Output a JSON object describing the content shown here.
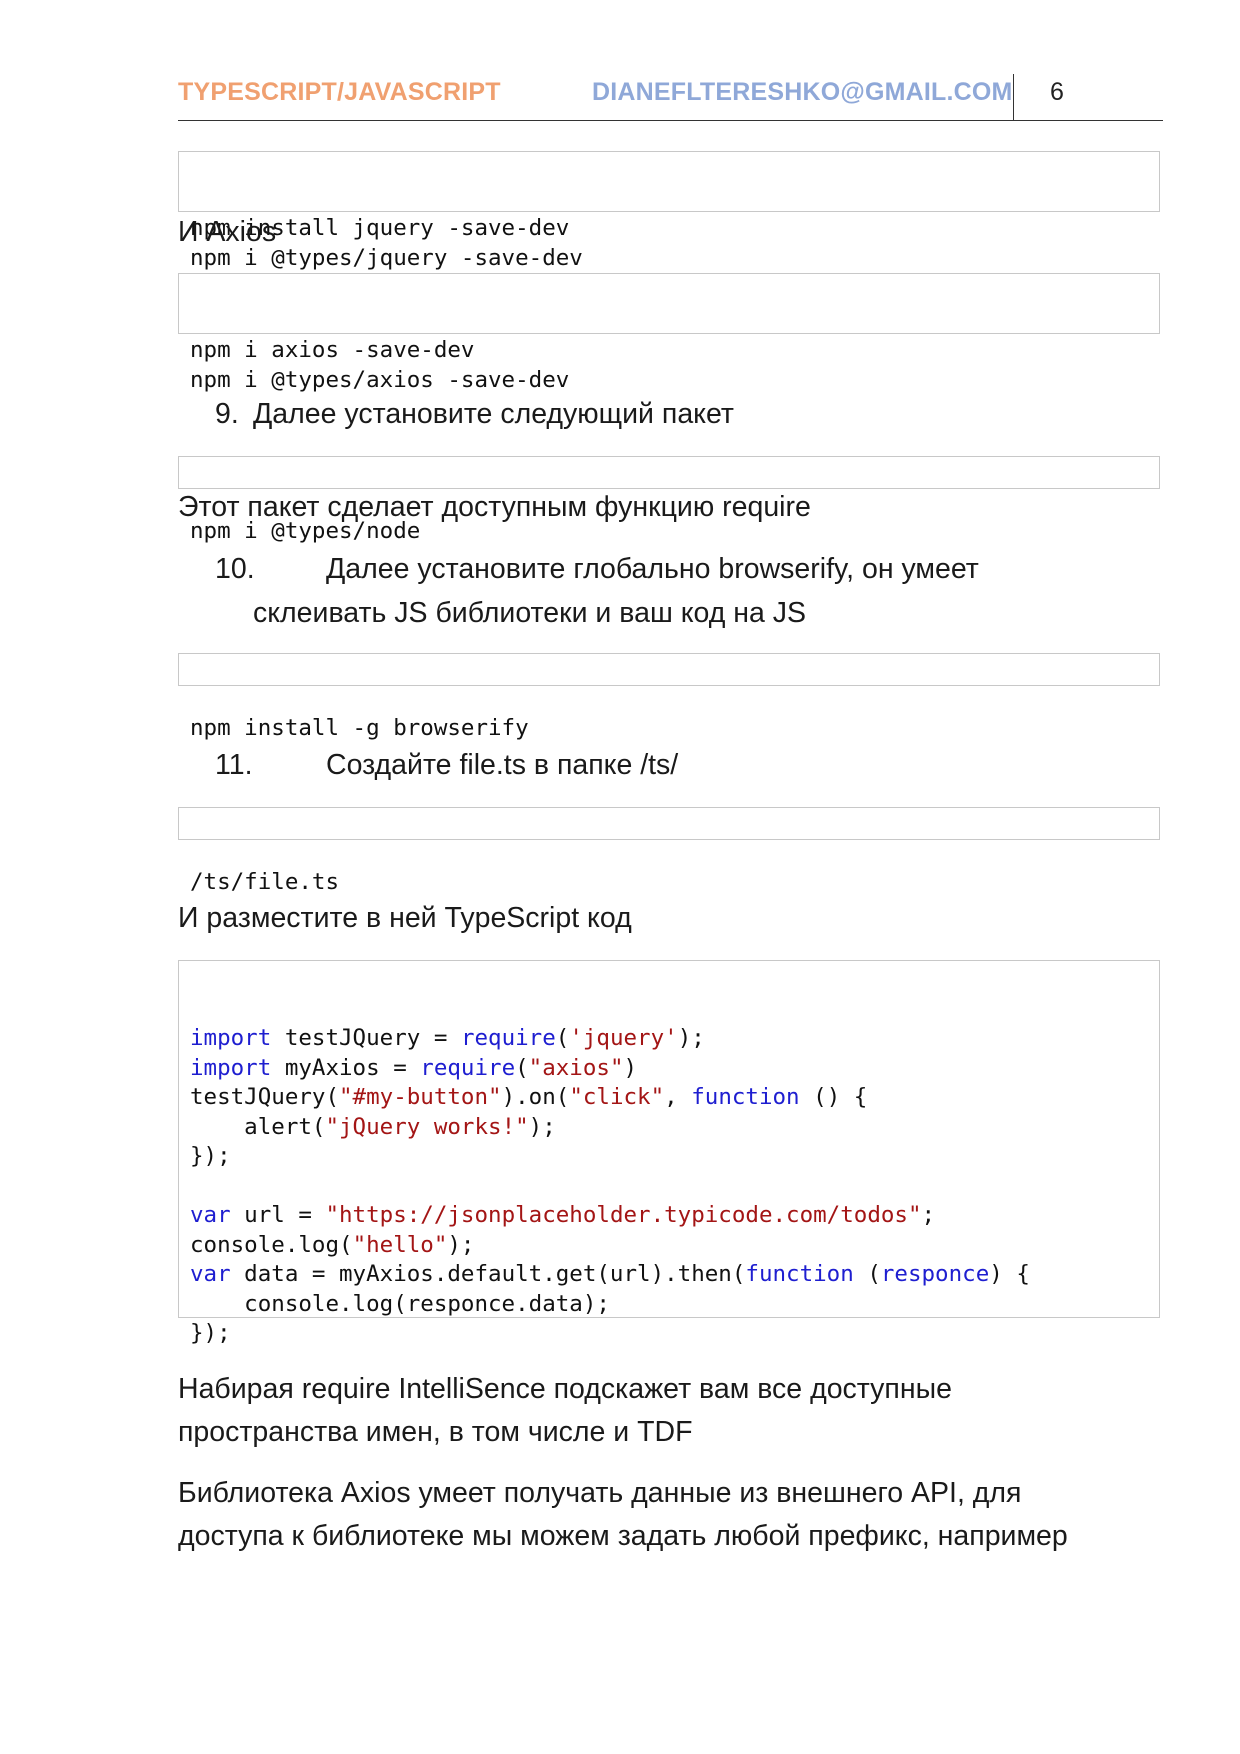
{
  "header": {
    "title": "TYPESCRIPT/JAVASCRIPT",
    "email": "DIANEFLTERESHKO@GMAIL.COM",
    "page_number": "6",
    "title_color": "#f0a070",
    "email_color": "#8fa8d8"
  },
  "code_jquery": [
    "npm install jquery -save-dev",
    "npm i @types/jquery -save-dev"
  ],
  "axios_label": "И Axios",
  "code_axios": [
    "npm i axios -save-dev",
    "npm i @types/axios -save-dev"
  ],
  "step9": {
    "num": "9.",
    "text": "Далее установите следующий пакет"
  },
  "code_node": "npm i @types/node",
  "node_note": "Этот пакет сделает доступным функцию require",
  "step10": {
    "num": "10.",
    "text_line1": "Далее установите глобально browserify, он умеет",
    "text_line2": "склеивать JS библиотеки и ваш код на JS"
  },
  "code_browserify": "npm install -g browserify",
  "step11": {
    "num": "11.",
    "text": "Создайте file.ts в папке /ts/"
  },
  "code_path": "/ts/file.ts",
  "place_code_label": "И разместите в ней TypeScript код",
  "ts_code": {
    "l1": {
      "kw1": "import",
      "t1": " testJQuery = ",
      "kw2": "require",
      "t2": "(",
      "s1": "'jquery'",
      "t3": ");"
    },
    "l2": {
      "kw1": "import",
      "t1": " myAxios = ",
      "kw2": "require",
      "t2": "(",
      "s1": "\"axios\"",
      "t3": ")"
    },
    "l3": {
      "t1": "testJQuery(",
      "s1": "\"#my-button\"",
      "t2": ").on(",
      "s2": "\"click\"",
      "t3": ", ",
      "kw1": "function",
      "t4": " () {"
    },
    "l4": {
      "t1": "    alert(",
      "s1": "\"jQuery works!\"",
      "t2": ");"
    },
    "l5": "});",
    "l7": {
      "kw1": "var",
      "t1": " url = ",
      "s1": "\"https://jsonplaceholder.typicode.com/todos\"",
      "t2": ";"
    },
    "l8": {
      "t1": "console.log(",
      "s1": "\"hello\"",
      "t2": ");"
    },
    "l9": {
      "kw1": "var",
      "t1": " data = myAxios.default.get(url).then(",
      "kw2": "function",
      "t2": " (",
      "kw3": "responce",
      "t3": ") {"
    },
    "l10": "    console.log(responce.data);",
    "l11": "});"
  },
  "intellisense_line1": "Набирая require IntelliSence подскажет вам все доступные",
  "intellisense_line2": "пространства имен, в том числе и TDF",
  "axios_note_line1": "Библиотека Axios умеет получать данные из внешнего API, для",
  "axios_note_line2": "доступа к библиотеке мы можем задать любой префикс, например"
}
